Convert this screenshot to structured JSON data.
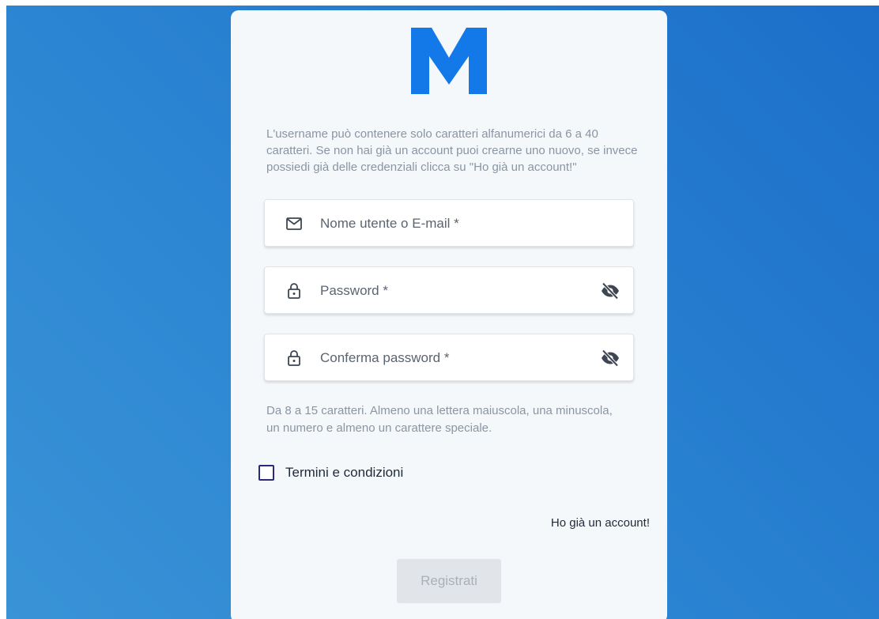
{
  "brand": {
    "logo_letter": "M",
    "logo_color": "#1479e8"
  },
  "form": {
    "intro_text": "L'username può contenere solo caratteri alfanumerici da 6 a 40 caratteri. Se non hai già un account puoi crearne uno nuovo, se invece possiedi già delle credenziali clicca su \"Ho già un account!\"",
    "username": {
      "placeholder": "Nome utente o E-mail *",
      "value": "",
      "icon": "mail-icon"
    },
    "password": {
      "placeholder": "Password *",
      "value": "",
      "icon": "lock-icon",
      "toggle_icon": "eye-off-icon"
    },
    "confirm_password": {
      "placeholder": "Conferma password *",
      "value": "",
      "icon": "lock-icon",
      "toggle_icon": "eye-off-icon"
    },
    "password_hint": "Da 8 a 15 caratteri. Almeno una lettera maiuscola, una minuscola, un numero e almeno un carattere speciale.",
    "terms_label": "Termini e condizioni",
    "terms_checked": false,
    "login_link": "Ho già un account!",
    "submit_label": "Registrati",
    "submit_enabled": false
  },
  "colors": {
    "background_gradient_start": "#3a93d6",
    "background_gradient_end": "#1c6fc9",
    "card_background": "#f5f8fb",
    "checkbox_border": "#2a2a7a",
    "button_disabled_bg": "#e1e5ea",
    "button_disabled_text": "#a9b0b9"
  }
}
